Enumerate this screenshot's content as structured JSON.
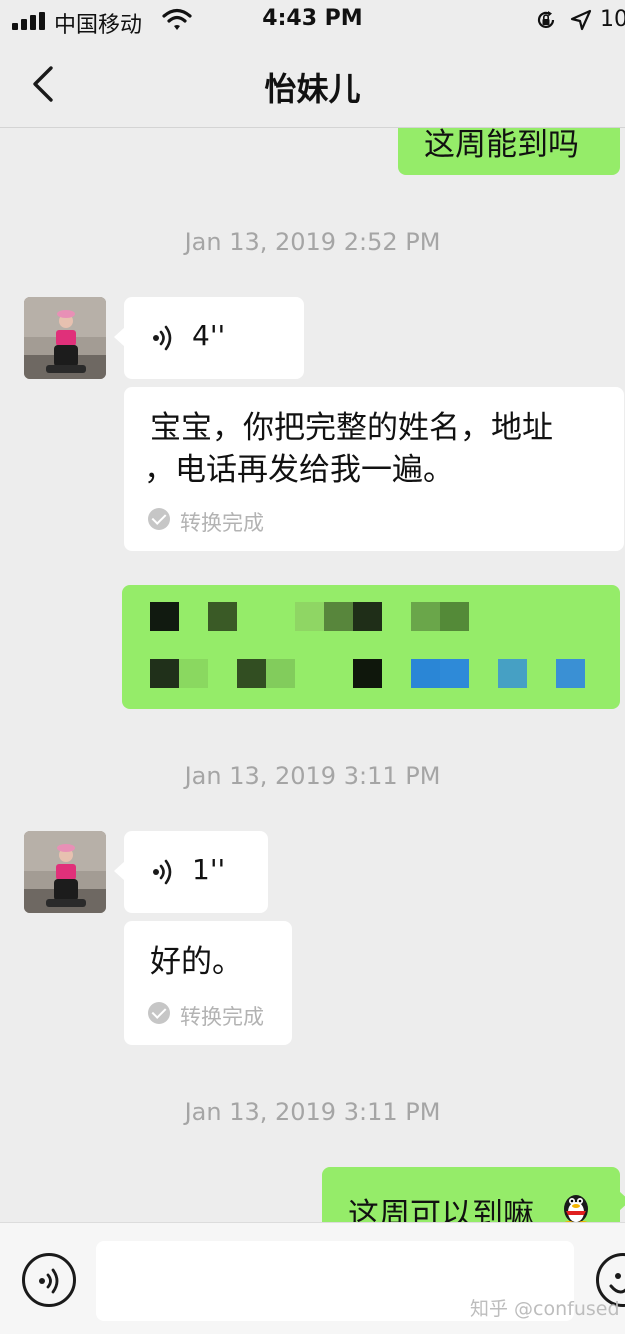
{
  "status_bar": {
    "carrier": "中国移动",
    "time": "4:43 PM",
    "battery_text": "10"
  },
  "nav": {
    "title": "怡妹儿"
  },
  "messages": {
    "top_partial_text": "这周能到吗",
    "timestamp_1": "Jan 13, 2019 2:52 PM",
    "voice_1_duration": "4''",
    "transcript_1_line1": "宝宝，你把完整的姓名，地址",
    "transcript_1_line2": "，电话再发给我一遍。",
    "transcript_status": "转换完成",
    "timestamp_2": "Jan 13, 2019 3:11 PM",
    "voice_2_duration": "1''",
    "transcript_2": "好的。",
    "timestamp_3": "Jan 13, 2019 3:11 PM",
    "last_sent_text": "这周可以到嘛"
  },
  "input_bar": {
    "input_value": ""
  },
  "watermark": "知乎 @confused",
  "icons": [
    "signal-icon",
    "wifi-icon",
    "orientation-lock-icon",
    "location-arrow-icon",
    "back-chevron-icon",
    "voice-wave-icon",
    "check-circle-icon",
    "qq-penguin-emoji",
    "voice-input-icon",
    "emoji-icon"
  ],
  "colors": {
    "background": "#ededed",
    "sent_bubble": "#95ec69",
    "received_bubble": "#ffffff",
    "timestamp": "#a5a5a5",
    "status_gray": "#b3b3b3"
  }
}
